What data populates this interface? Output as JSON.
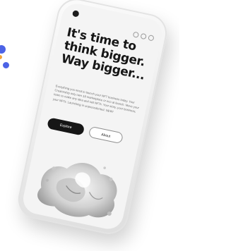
{
  "device": {
    "topbar_icons": [
      "menu-icon",
      "user-icon",
      "search-icon"
    ]
  },
  "hero": {
    "headline": [
      "It's time to",
      "think bigger.",
      "Way bigger..."
    ],
    "body": "Everything you need to launch your NFT business today. Your Creatorship only own 18 marketplace or eco at launch. Move your team to make any idea and sell NFTs. Your story, your business, your NFTs. Launching in unprecedented. NEW!"
  },
  "buttons": {
    "explore": "Explore",
    "about": "About"
  },
  "colors": {
    "accent_dot": "#4c63e6",
    "secondary_dot": "#f2a23a",
    "primary_button": "#161616"
  }
}
